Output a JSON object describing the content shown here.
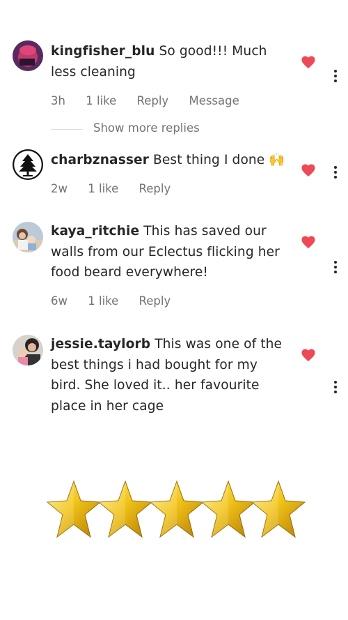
{
  "comments": [
    {
      "username": "kingfisher_blu",
      "text": "So good!!! Much less cleaning",
      "time": "3h",
      "likes": "1 like",
      "reply": "Reply",
      "message": "Message",
      "liked": true
    },
    {
      "username": "charbznasser",
      "text": "Best thing I done 🙌",
      "time": "2w",
      "likes": "1 like",
      "reply": "Reply",
      "liked": true
    },
    {
      "username": "kaya_ritchie",
      "text": "This has saved our walls from our Eclectus flicking her food beard everywhere!",
      "time": "6w",
      "likes": "1 like",
      "reply": "Reply",
      "liked": true
    },
    {
      "username": "jessie.taylorb",
      "text": "This was one of the best things i had bought for my bird. She loved it.. her favourite place in her cage",
      "liked": true
    }
  ],
  "show_more_replies": "Show more replies",
  "rating": {
    "stars": 5,
    "max": 5
  },
  "colors": {
    "heart": "#ed4956",
    "meta_text": "#737373",
    "star_gold": "#f2c418"
  }
}
